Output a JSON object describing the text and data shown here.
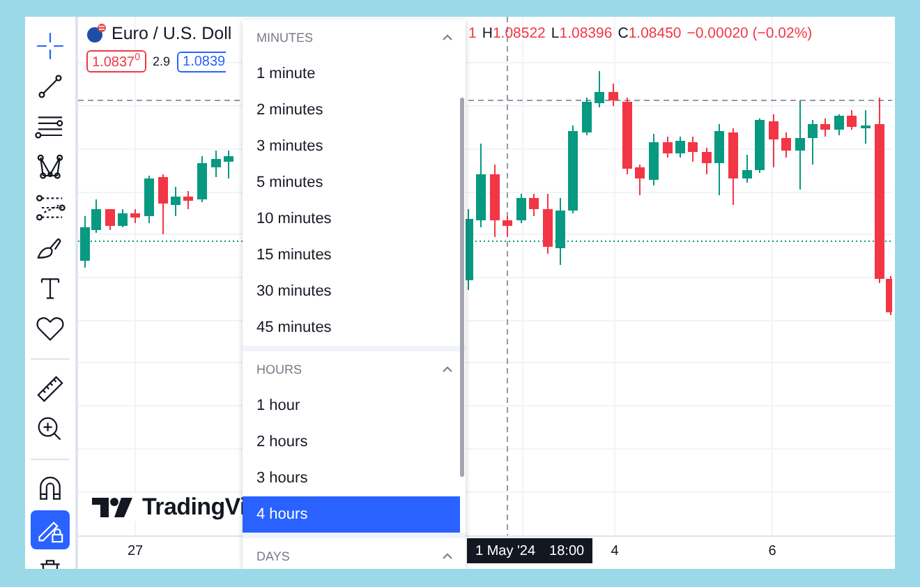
{
  "toolbar": {
    "tools": [
      {
        "kind": "crosshair",
        "selected": true
      },
      {
        "kind": "trend-line",
        "selected": false
      },
      {
        "kind": "horizontal-lines",
        "selected": false
      },
      {
        "kind": "pattern",
        "selected": false
      },
      {
        "kind": "channel",
        "selected": false
      },
      {
        "kind": "brush",
        "selected": false
      },
      {
        "kind": "text",
        "selected": false
      },
      {
        "kind": "heart",
        "selected": false
      }
    ],
    "measure": [
      {
        "kind": "ruler"
      },
      {
        "kind": "zoom-in"
      }
    ],
    "toggles": [
      {
        "kind": "magnet",
        "on": false
      },
      {
        "kind": "lock-drawings",
        "on": true
      },
      {
        "kind": "trash",
        "on": false
      }
    ]
  },
  "chart": {
    "symbol": "Euro / U.S. Doll",
    "sell_price": "1.0837$^{0}$",
    "spread": "2.9",
    "buy_price": "1.0839",
    "ohlc": {
      "lead": "1",
      "fields": [
        {
          "label": "H",
          "value": "1.08522"
        },
        {
          "label": "L",
          "value": "1.08396"
        },
        {
          "label": "C",
          "value": "1.08450"
        }
      ],
      "change": "−0.00020 (−0.02%)"
    },
    "logo": "TradingVi",
    "time_axis": [
      {
        "kind": "tick",
        "label": "27"
      },
      {
        "kind": "crosshair",
        "label": "1 May '24",
        "time": "18:00"
      },
      {
        "kind": "tick",
        "label": "4"
      },
      {
        "kind": "tick",
        "label": "6"
      }
    ]
  },
  "interval_menu": {
    "sections": [
      {
        "title": "MINUTES",
        "expanded": true,
        "items": [
          {
            "label": "1 minute",
            "selected": false
          },
          {
            "label": "2 minutes",
            "selected": false
          },
          {
            "label": "3 minutes",
            "selected": false
          },
          {
            "label": "5 minutes",
            "selected": false
          },
          {
            "label": "10 minutes",
            "selected": false
          },
          {
            "label": "15 minutes",
            "selected": false
          },
          {
            "label": "30 minutes",
            "selected": false
          },
          {
            "label": "45 minutes",
            "selected": false
          }
        ]
      },
      {
        "title": "HOURS",
        "expanded": true,
        "items": [
          {
            "label": "1 hour",
            "selected": false
          },
          {
            "label": "2 hours",
            "selected": false
          },
          {
            "label": "3 hours",
            "selected": false
          },
          {
            "label": "4 hours",
            "selected": true
          }
        ]
      },
      {
        "title": "DAYS",
        "expanded": true
      }
    ]
  }
}
